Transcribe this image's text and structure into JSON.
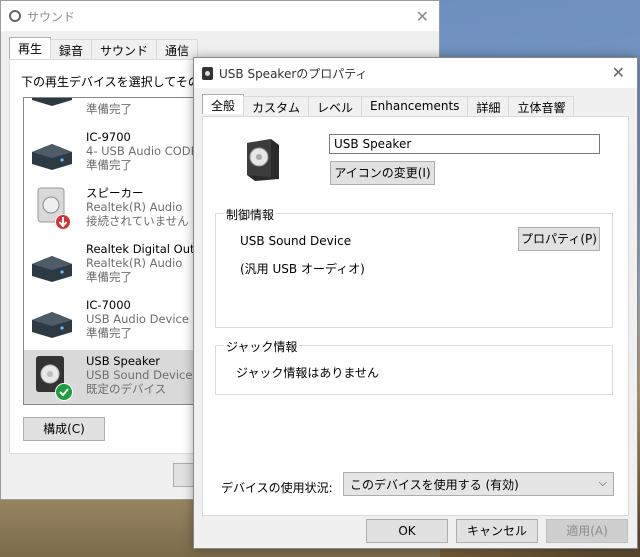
{
  "back_window": {
    "title": "サウンド",
    "tabs": [
      "再生",
      "録音",
      "サウンド",
      "通信"
    ],
    "instruction": "下の再生デバイスを選択してその設定を",
    "devices": [
      {
        "line1": "",
        "line2": "準備完了",
        "line3": ""
      },
      {
        "line1": "IC-9700",
        "line2": "4- USB Audio CODEC",
        "line3": "準備完了"
      },
      {
        "line1": "スピーカー",
        "line2": "Realtek(R) Audio",
        "line3": "接続されていません"
      },
      {
        "line1": "Realtek Digital Output",
        "line2": "Realtek(R) Audio",
        "line3": "準備完了"
      },
      {
        "line1": "IC-7000",
        "line2": "USB Audio Device",
        "line3": "準備完了"
      },
      {
        "line1": "USB Speaker",
        "line2": "USB Sound Device",
        "line3": "既定のデバイス"
      }
    ],
    "configure_label": "構成(C)"
  },
  "dialog": {
    "title": "USB Speakerのプロパティ",
    "tabs": [
      "全般",
      "カスタム",
      "レベル",
      "Enhancements",
      "詳細",
      "立体音響"
    ],
    "device_name": "USB Speaker",
    "change_icon_label": "アイコンの変更(I)",
    "controller_group": "制御情報",
    "controller_name": "USB Sound Device",
    "controller_sub": "(汎用 USB オーディオ)",
    "properties_label": "プロパティ(P)",
    "jack_group": "ジャック情報",
    "jack_text": "ジャック情報はありません",
    "usage_label": "デバイスの使用状況:",
    "usage_value": "このデバイスを使用する (有効)",
    "ok_label": "OK",
    "cancel_label": "キャンセル",
    "apply_label": "適用(A)"
  }
}
